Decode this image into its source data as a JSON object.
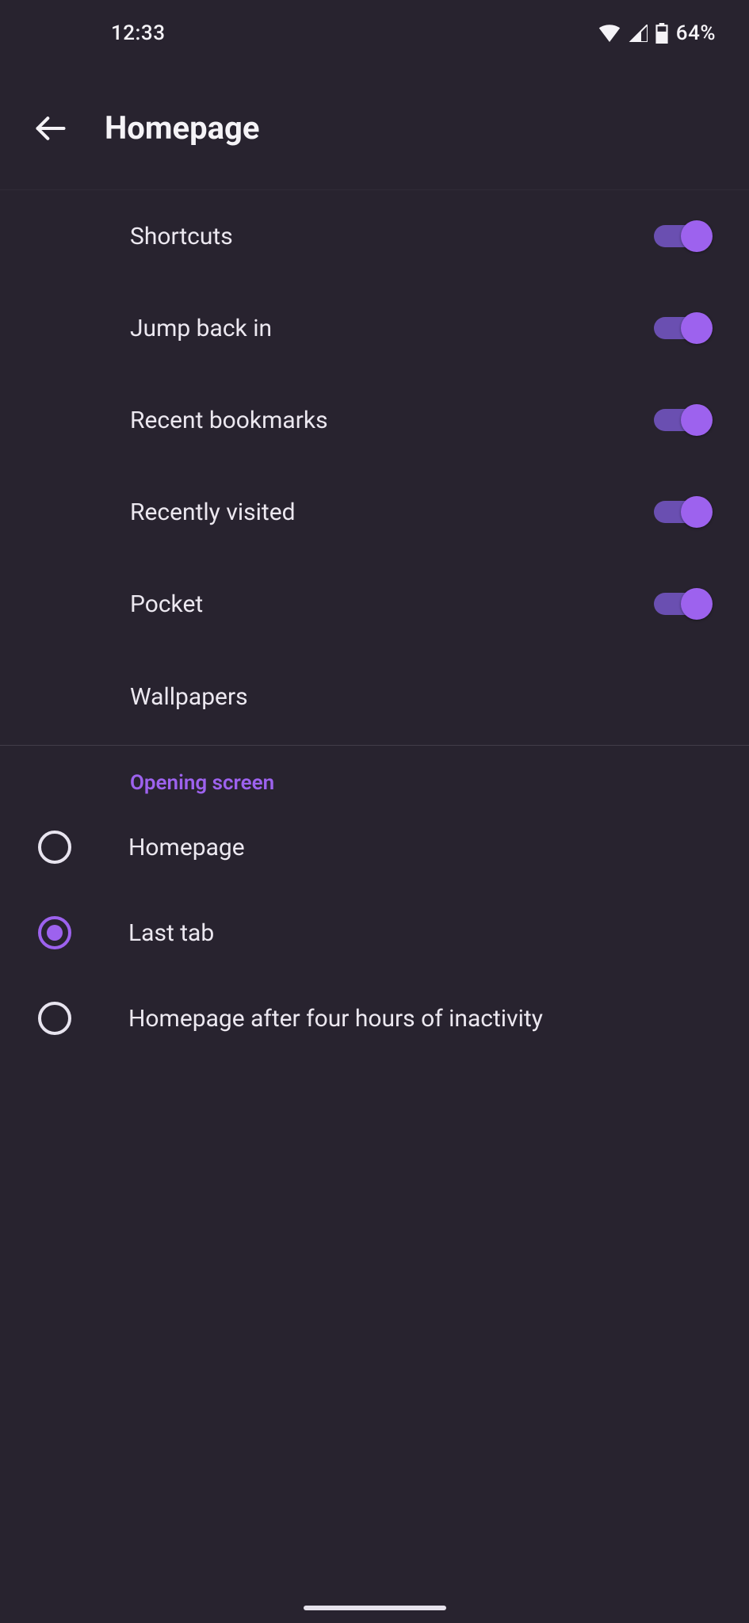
{
  "status": {
    "time": "12:33",
    "battery": "64%"
  },
  "appbar": {
    "title": "Homepage"
  },
  "toggles": [
    {
      "label": "Shortcuts",
      "on": true
    },
    {
      "label": "Jump back in",
      "on": true
    },
    {
      "label": "Recent bookmarks",
      "on": true
    },
    {
      "label": "Recently visited",
      "on": true
    },
    {
      "label": "Pocket",
      "on": true
    }
  ],
  "link_rows": [
    {
      "label": "Wallpapers"
    }
  ],
  "section": {
    "title": "Opening screen",
    "options": [
      {
        "label": "Homepage",
        "selected": false
      },
      {
        "label": "Last tab",
        "selected": true
      },
      {
        "label": "Homepage after four hours of inactivity",
        "selected": false
      }
    ]
  }
}
